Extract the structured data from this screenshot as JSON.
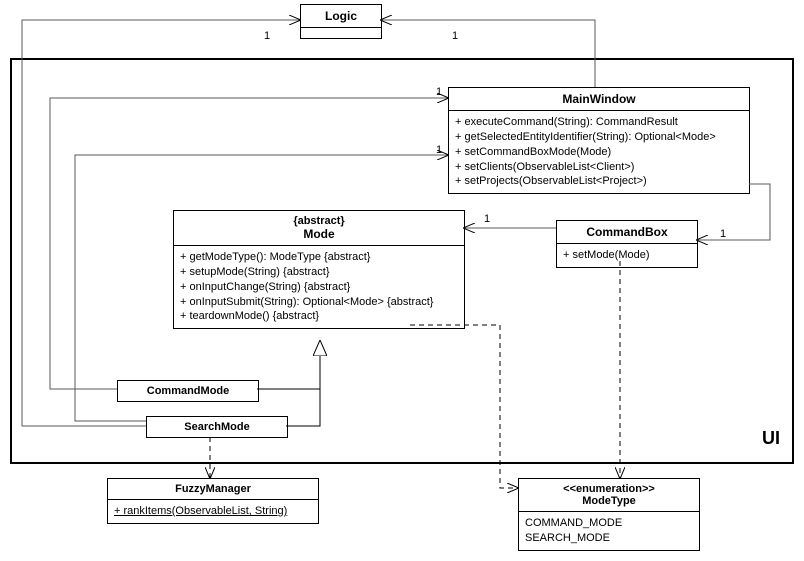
{
  "ui_label": "UI",
  "logic": {
    "title": "Logic"
  },
  "mainwindow": {
    "title": "MainWindow",
    "m0": "+ executeCommand(String): CommandResult",
    "m1": "+ getSelectedEntityIdentifier(String): Optional<Mode>",
    "m2": "+ setCommandBoxMode(Mode)",
    "m3": "+ setClients(ObservableList<Client>)",
    "m4": "+ setProjects(ObservableList<Project>)"
  },
  "mode": {
    "stereotype": "{abstract}",
    "title": "Mode",
    "m0": "+ getModeType(): ModeType {abstract}",
    "m1": "+ setupMode(String) {abstract}",
    "m2": "+ onInputChange(String) {abstract}",
    "m3": "+ onInputSubmit(String): Optional<Mode> {abstract}",
    "m4": "+ teardownMode() {abstract}"
  },
  "commandbox": {
    "title": "CommandBox",
    "m0": "+ setMode(Mode)"
  },
  "commandmode": {
    "title": "CommandMode"
  },
  "searchmode": {
    "title": "SearchMode"
  },
  "fuzzymanager": {
    "title": "FuzzyManager",
    "m0": "+ rankItems(ObservableList, String)"
  },
  "modetype": {
    "stereotype": "<<enumeration>>",
    "title": "ModeType",
    "v0": "COMMAND_MODE",
    "v1": "SEARCH_MODE"
  },
  "mult": {
    "logic_left": "1",
    "logic_right": "1",
    "main_top": "1",
    "main_left": "1",
    "mode_right": "1",
    "cmdbox_right": "1"
  }
}
